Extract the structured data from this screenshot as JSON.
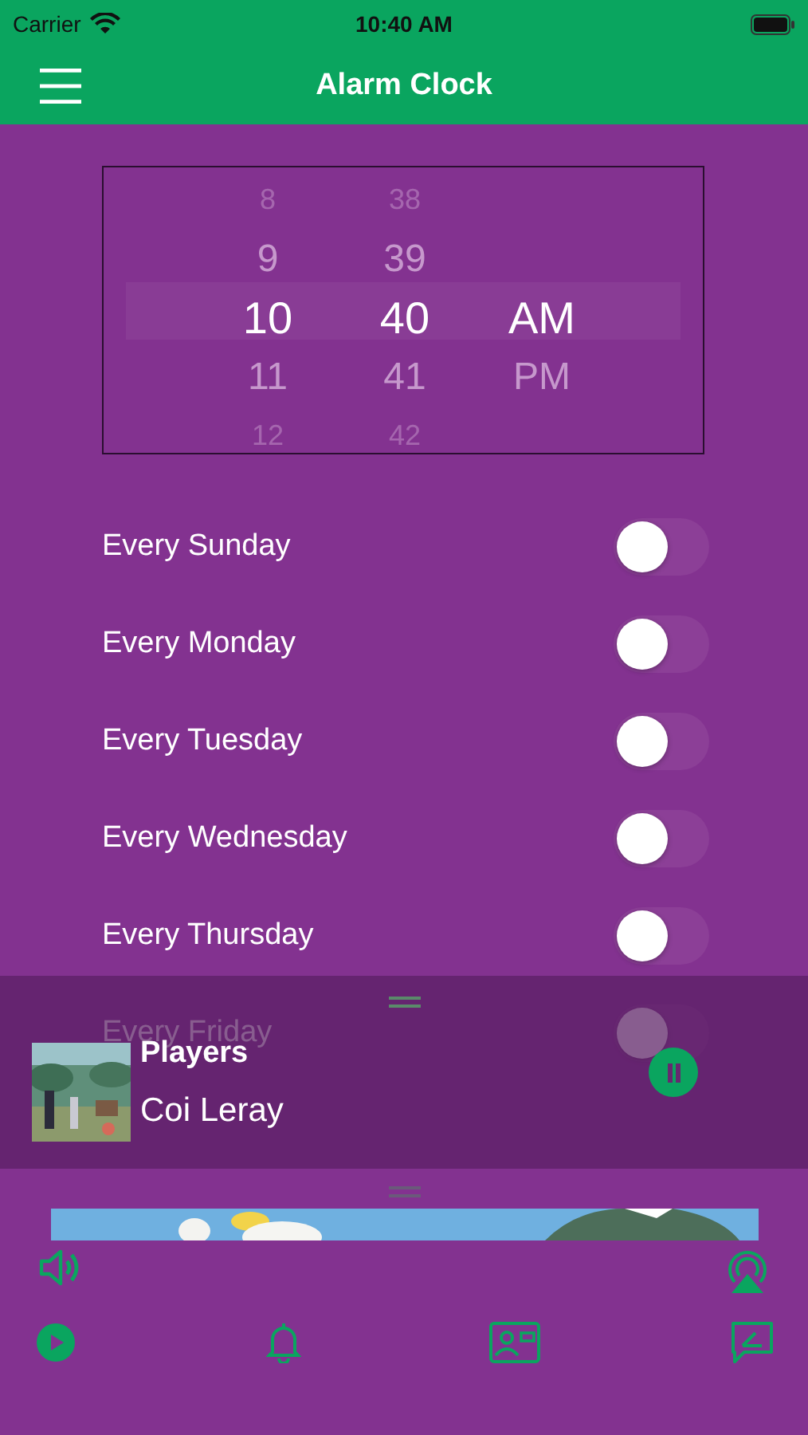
{
  "status_bar": {
    "carrier": "Carrier",
    "time": "10:40 AM"
  },
  "nav": {
    "title": "Alarm Clock"
  },
  "time_picker": {
    "columns": [
      {
        "items": [
          {
            "label": "8",
            "selected": false
          },
          {
            "label": "9",
            "selected": false
          },
          {
            "label": "10",
            "selected": true
          },
          {
            "label": "11",
            "selected": false
          },
          {
            "label": "12",
            "selected": false
          }
        ]
      },
      {
        "items": [
          {
            "label": "38",
            "selected": false
          },
          {
            "label": "39",
            "selected": false
          },
          {
            "label": "40",
            "selected": true
          },
          {
            "label": "41",
            "selected": false
          },
          {
            "label": "42",
            "selected": false
          }
        ]
      },
      {
        "items": [
          {
            "label": "AM",
            "selected": true
          },
          {
            "label": "PM",
            "selected": false
          }
        ]
      }
    ]
  },
  "repeat_days": [
    {
      "label": "Every Sunday",
      "on": false
    },
    {
      "label": "Every Monday",
      "on": false
    },
    {
      "label": "Every Tuesday",
      "on": false
    },
    {
      "label": "Every Wednesday",
      "on": false
    },
    {
      "label": "Every Thursday",
      "on": false
    },
    {
      "label": "Every Friday",
      "on": false
    }
  ],
  "mini_player": {
    "title": "Players",
    "artist": "Coi Leray",
    "playing": true
  },
  "tab_bar": {
    "items": [
      {
        "kind": "play"
      },
      {
        "kind": "bell"
      },
      {
        "kind": "card"
      },
      {
        "kind": "compose"
      }
    ]
  }
}
